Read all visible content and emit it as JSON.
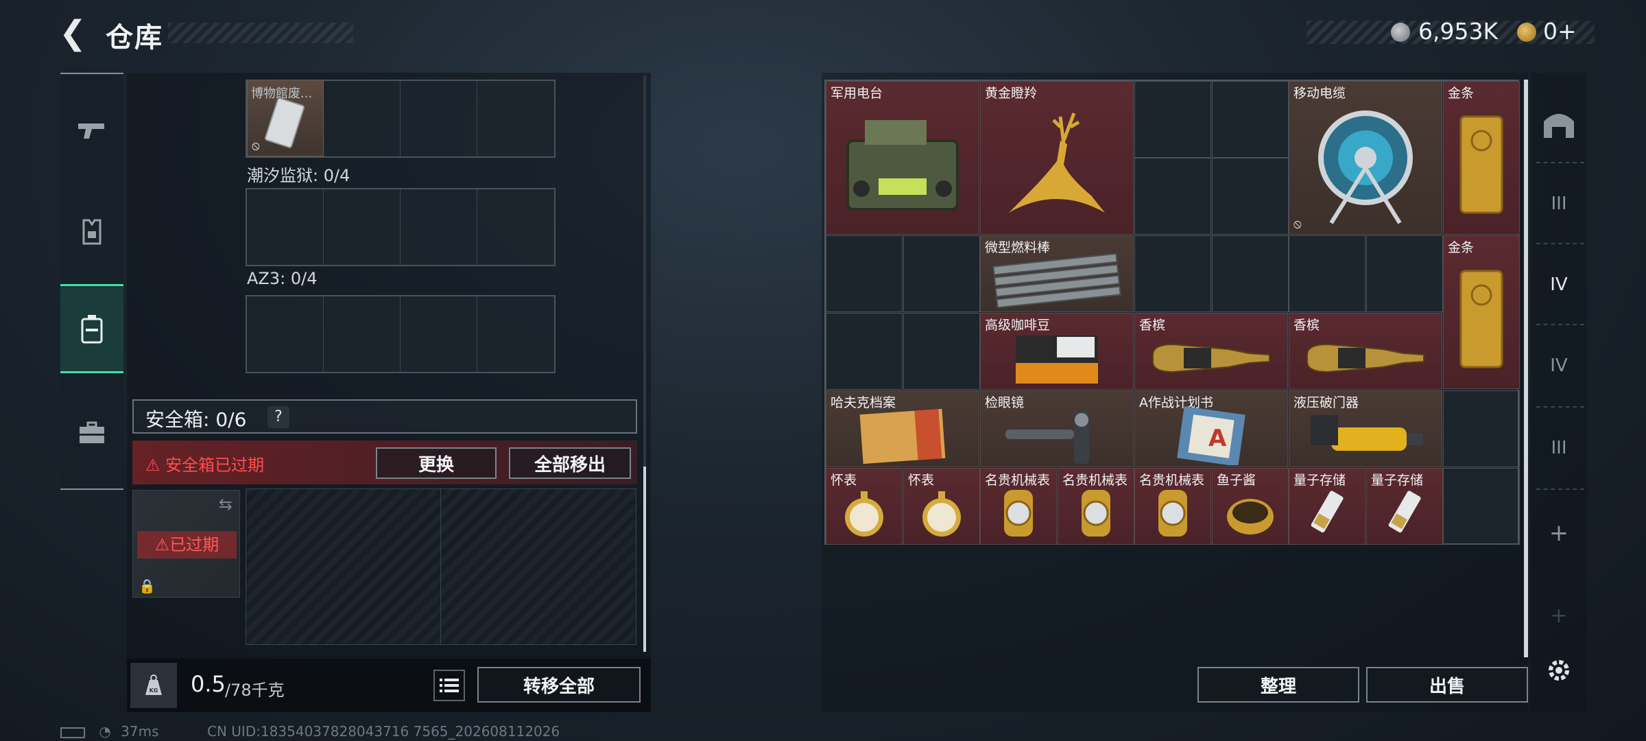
{
  "header": {
    "back_label": "<",
    "title": "仓库"
  },
  "currency": {
    "silver_value": "6,953K",
    "gold_value": "0+"
  },
  "left_nav": {
    "items": [
      {
        "name": "weapons"
      },
      {
        "name": "gear"
      },
      {
        "name": "backpack",
        "active": true
      },
      {
        "name": "toolbox"
      }
    ]
  },
  "containers": {
    "museum_item": "博物館废...",
    "tide_prison": "潮汐监狱: 0/4",
    "az3": "AZ3: 0/4"
  },
  "safe_box": {
    "label": "安全箱: 0/6",
    "help": "?",
    "expired_notice": "安全箱已过期",
    "replace_button": "更换",
    "remove_all_button": "全部移出",
    "thumb_expired": "已过期"
  },
  "footer_left": {
    "kg_icon": "KG",
    "weight": "0.5",
    "max_weight": "/78千克",
    "transfer_all_button": "转移全部"
  },
  "status": {
    "ping": "37ms",
    "uid": "CN UID:18354037828043716 7565_202608112026"
  },
  "stash": {
    "items": [
      {
        "name": "军用电台",
        "color": "red"
      },
      {
        "name": "黄金瞪羚",
        "color": "red"
      },
      {
        "name": "移动电缆",
        "color": "brown"
      },
      {
        "name": "金条",
        "color": "red"
      },
      {
        "name": "微型燃料棒",
        "color": "brown"
      },
      {
        "name": "金条",
        "color": "red"
      },
      {
        "name": "高级咖啡豆",
        "color": "red"
      },
      {
        "name": "香槟",
        "color": "red"
      },
      {
        "name": "香槟",
        "color": "red"
      },
      {
        "name": "哈夫克档案",
        "color": "brown"
      },
      {
        "name": "检眼镜",
        "color": "brown"
      },
      {
        "name": "A作战计划书",
        "color": "brown"
      },
      {
        "name": "液压破门器",
        "color": "brown"
      },
      {
        "name": "怀表",
        "color": "red"
      },
      {
        "name": "怀表",
        "color": "red"
      },
      {
        "name": "名贵机械表",
        "color": "red"
      },
      {
        "name": "名贵机械表",
        "color": "red"
      },
      {
        "name": "名贵机械表",
        "color": "red"
      },
      {
        "name": "鱼子酱",
        "color": "red"
      },
      {
        "name": "量子存储",
        "color": "red"
      },
      {
        "name": "量子存储",
        "color": "red"
      }
    ],
    "sort_button": "整理",
    "sell_button": "出售"
  },
  "right_side": {
    "tabs": [
      "III",
      "IV",
      "IV",
      "III"
    ],
    "add": "+"
  }
}
